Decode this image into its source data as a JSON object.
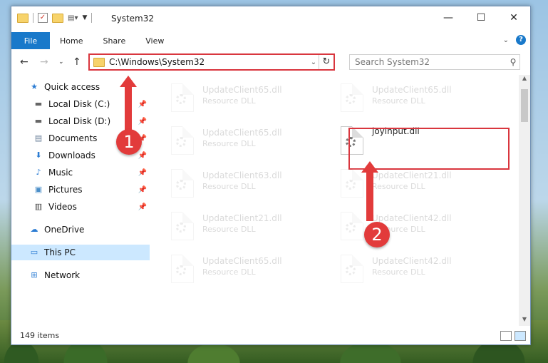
{
  "window": {
    "title": "System32"
  },
  "ribbon": {
    "tabs": [
      "File",
      "Home",
      "Share",
      "View"
    ]
  },
  "address_bar": {
    "path": "C:\\Windows\\System32"
  },
  "search": {
    "placeholder": "Search System32"
  },
  "sidebar": {
    "items": [
      {
        "label": "Quick access",
        "icon": "star-icon"
      },
      {
        "label": "Local Disk (C:)",
        "icon": "drive-icon"
      },
      {
        "label": "Local Disk (D:)",
        "icon": "drive-icon"
      },
      {
        "label": "Documents",
        "icon": "documents-icon"
      },
      {
        "label": "Downloads",
        "icon": "downloads-icon"
      },
      {
        "label": "Music",
        "icon": "music-icon"
      },
      {
        "label": "Pictures",
        "icon": "pictures-icon"
      },
      {
        "label": "Videos",
        "icon": "videos-icon"
      },
      {
        "label": "OneDrive",
        "icon": "cloud-icon"
      },
      {
        "label": "This PC",
        "icon": "computer-icon",
        "selected": true
      },
      {
        "label": "Network",
        "icon": "network-icon"
      }
    ]
  },
  "files": [
    {
      "name": "UpdateClient65.dll",
      "type": "Resource DLL"
    },
    {
      "name": "UpdateClient65.dll",
      "type": "Resource DLL"
    },
    {
      "name": "UpdateClient65.dll",
      "type": "Resource DLL"
    },
    {
      "name": "joyinput.dll",
      "type": ""
    },
    {
      "name": "UpdateClient63.dll",
      "type": "Resource DLL"
    },
    {
      "name": "UpdateClient21.dll",
      "type": "Resource DLL"
    },
    {
      "name": "UpdateClient21.dll",
      "type": "Resource DLL"
    },
    {
      "name": "UpdateClient42.dll",
      "type": "Resource DLL"
    },
    {
      "name": "UpdateClient65.dll",
      "type": "Resource DLL"
    },
    {
      "name": "UpdateClient42.dll",
      "type": "Resource DLL"
    }
  ],
  "status": {
    "item_count": "149 items"
  },
  "callouts": [
    "1",
    "2"
  ],
  "colors": {
    "highlight": "#d9363e",
    "accent": "#1979ca",
    "selection": "#cce8ff"
  }
}
